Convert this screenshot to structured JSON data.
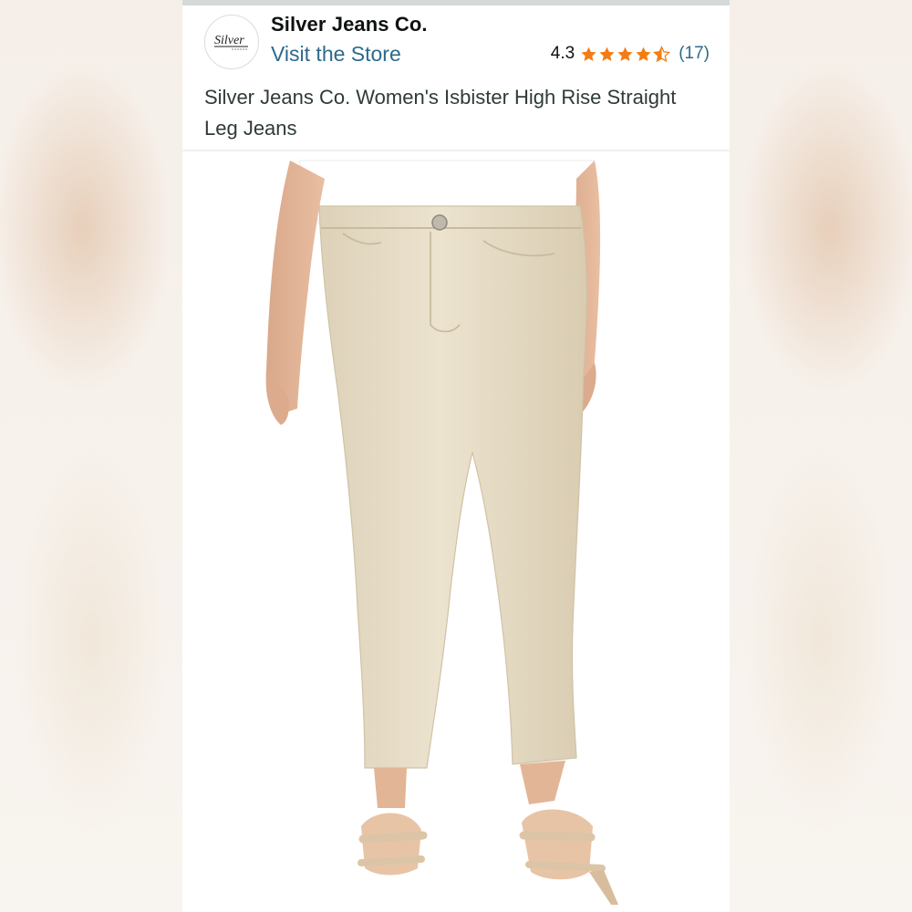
{
  "store": {
    "name": "Silver Jeans Co.",
    "visit_link": "Visit the Store",
    "logo_text": "Silver"
  },
  "rating": {
    "value": "4.3",
    "stars": 4.3,
    "count": "(17)",
    "star_color": "#f47c14"
  },
  "product": {
    "title": "Silver Jeans Co. Women's Isbister High Rise Straight Leg Jeans"
  },
  "colors": {
    "link": "#2d6a8c",
    "jeans": "#e9dfc9",
    "sandals": "#dcc5a6"
  }
}
